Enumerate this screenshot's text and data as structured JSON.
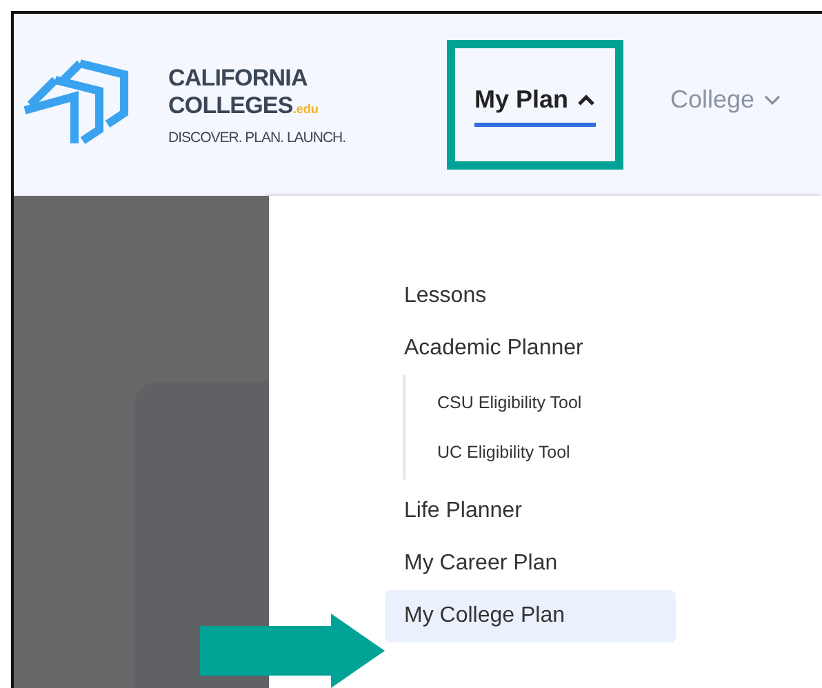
{
  "logo": {
    "name_line_1": "CALIFORNIA",
    "name_line_2": "COLLEGES",
    "domain": ".edu",
    "tagline": "DISCOVER. PLAN. LAUNCH."
  },
  "nav": [
    {
      "label": "My Plan",
      "selected": true,
      "expanded": true,
      "highlighted": true
    },
    {
      "label": "College",
      "selected": false,
      "expanded": false,
      "highlighted": false
    }
  ],
  "menu": [
    {
      "label": "Lessons",
      "selected": false
    },
    {
      "label": "Academic Planner",
      "selected": false,
      "children": [
        {
          "label": "CSU Eligibility Tool"
        },
        {
          "label": "UC Eligibility Tool"
        }
      ]
    },
    {
      "label": "Life Planner",
      "selected": false
    },
    {
      "label": "My Career Plan",
      "selected": false
    },
    {
      "label": "My College Plan",
      "selected": true,
      "pointed": true
    }
  ]
}
